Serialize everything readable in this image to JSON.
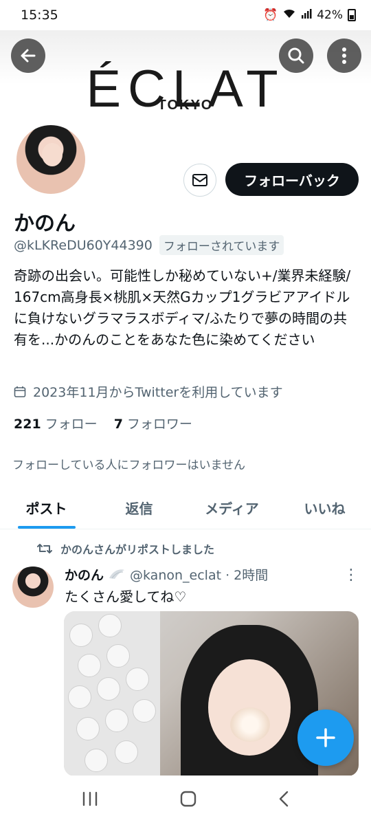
{
  "status": {
    "time": "15:35",
    "battery": "42%"
  },
  "banner": {
    "logo": "ÉCLAT",
    "sub": "TOKYO"
  },
  "profile": {
    "name": "かのん",
    "handle": "@kLKReDU60Y44390",
    "follows_you": "フォローされています",
    "follow_back_label": "フォローバック",
    "bio": "奇跡の出会い。可能性しか秘めていない+/業界未経験/ 167cm高身長×桃肌×天然Gカップ1グラビアアイドルに負けないグラマラスボディマ/ふたりで夢の時間の共有を...かのんのことをあなた色に染めてください",
    "joined": "2023年11月からTwitterを利用しています",
    "following_count": "221",
    "following_label": "フォロー",
    "followers_count": "7",
    "followers_label": "フォロワー",
    "no_mutual": "フォローしている人にフォロワーはいません"
  },
  "tabs": [
    {
      "label": "ポスト"
    },
    {
      "label": "返信"
    },
    {
      "label": "メディア"
    },
    {
      "label": "いいね"
    }
  ],
  "tweet": {
    "repost_text": "かのんさんがリポストしました",
    "name": "かのん",
    "meta": "@kanon_eclat · 2時間",
    "text": "たくさん愛してね♡"
  },
  "colors": {
    "accent": "#1d9bf0",
    "text": "#0f1419",
    "secondary": "#536471"
  }
}
